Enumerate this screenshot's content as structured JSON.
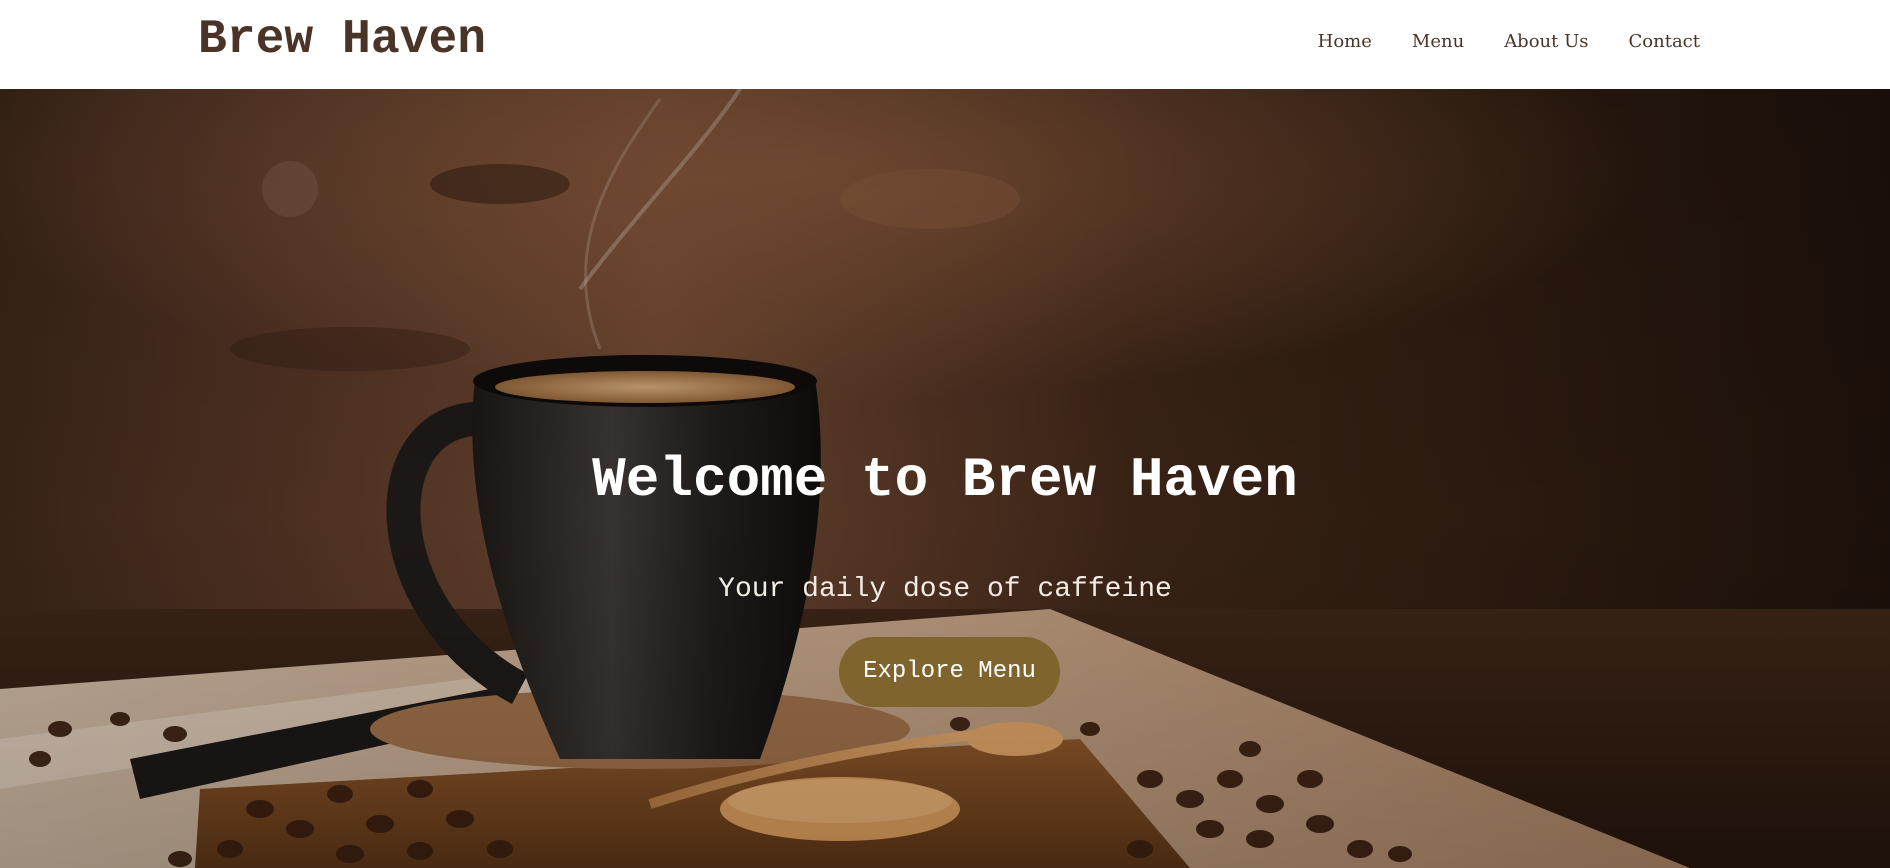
{
  "header": {
    "brand": "Brew Haven",
    "nav": [
      {
        "label": "Home"
      },
      {
        "label": "Menu"
      },
      {
        "label": "About Us"
      },
      {
        "label": "Contact"
      }
    ]
  },
  "hero": {
    "title": "Welcome to Brew Haven",
    "subtitle": "Your daily dose of caffeine",
    "cta_label": "Explore Menu",
    "image": "coffee-mug-with-beans-photo"
  },
  "colors": {
    "brand_text": "#4a3428",
    "header_bg": "#ffffff",
    "cta_bg": "#80642e",
    "hero_text": "#ffffff"
  }
}
